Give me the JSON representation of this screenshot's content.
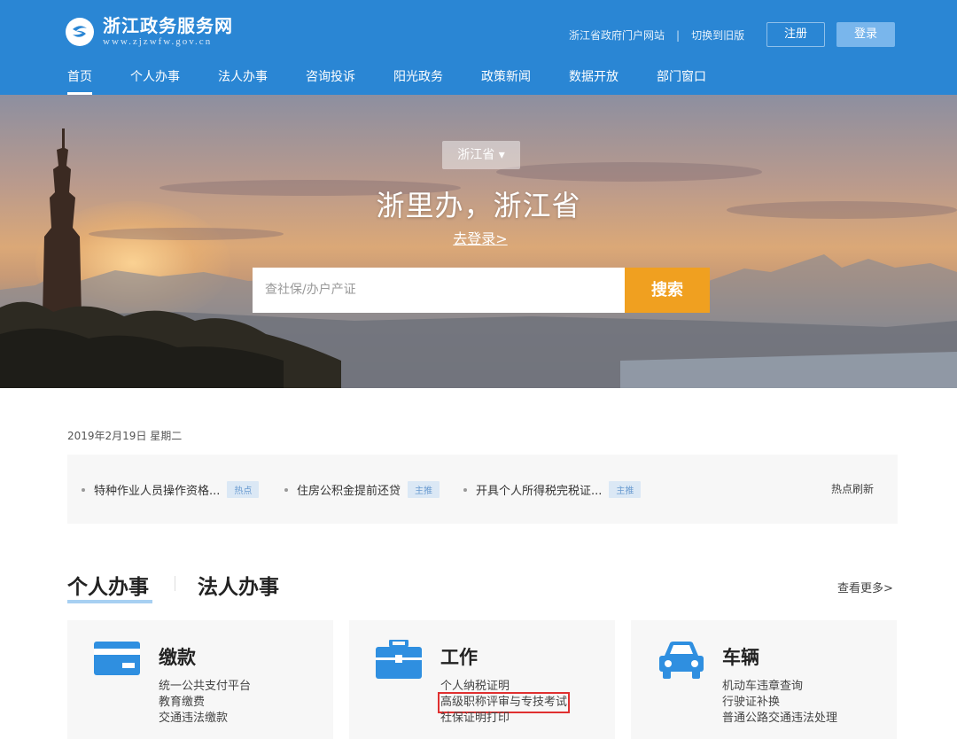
{
  "header": {
    "site_title": "浙江政务服务网",
    "site_url": "www.zjzwfw.gov.cn",
    "portal_link": "浙江省政府门户网站",
    "separator": "|",
    "old_version_link": "切换到旧版",
    "register_label": "注册",
    "login_label": "登录",
    "nav": [
      "首页",
      "个人办事",
      "法人办事",
      "咨询投诉",
      "阳光政务",
      "政策新闻",
      "数据开放",
      "部门窗口"
    ]
  },
  "banner": {
    "region": "浙江省",
    "title": "浙里办，浙江省",
    "login_link": "去登录>",
    "search_placeholder": "查社保/办户产证",
    "search_button": "搜索"
  },
  "date": "2019年2月19日 星期二",
  "hot": {
    "items": [
      {
        "text": "特种作业人员操作资格...",
        "tag": "热点"
      },
      {
        "text": "住房公积金提前还贷",
        "tag": "主推"
      },
      {
        "text": "开具个人所得税完税证...",
        "tag": "主推"
      }
    ],
    "refresh_label": "热点刷新"
  },
  "tabs": {
    "personal": "个人办事",
    "corporate": "法人办事",
    "more": "查看更多>"
  },
  "cards": [
    {
      "title": "缴款",
      "items": [
        "统一公共支付平台",
        "教育缴费",
        "交通违法缴款"
      ]
    },
    {
      "title": "工作",
      "items": [
        "个人纳税证明",
        "高级职称评审与专技考试",
        "社保证明打印"
      ]
    },
    {
      "title": "车辆",
      "items": [
        "机动车违章查询",
        "行驶证补换",
        "普通公路交通违法处理"
      ]
    }
  ],
  "colors": {
    "header_blue": "#2a86d4",
    "search_orange": "#f0a020",
    "icon_blue": "#2f8fe0",
    "highlight_red": "#e03030"
  }
}
